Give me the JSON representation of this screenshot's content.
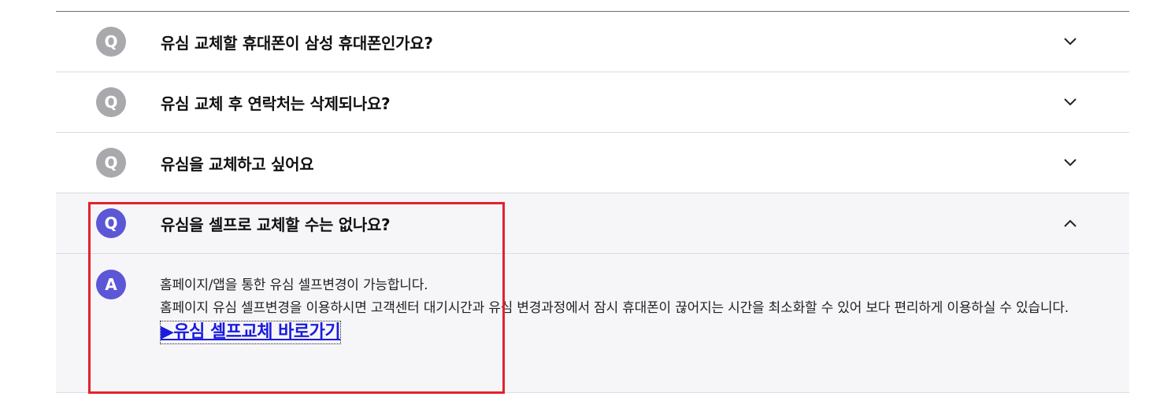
{
  "faq": {
    "items": [
      {
        "q_badge": "Q",
        "question": "유심 교체할 휴대폰이 삼성 휴대폰인가요?",
        "expanded": false
      },
      {
        "q_badge": "Q",
        "question": "유심 교체 후 연락처는 삭제되나요?",
        "expanded": false
      },
      {
        "q_badge": "Q",
        "question": "유심을 교체하고 싶어요",
        "expanded": false
      },
      {
        "q_badge": "Q",
        "question": "유심을 셀프로 교체할 수는 없나요?",
        "expanded": true
      }
    ],
    "answer": {
      "a_badge": "A",
      "line1": "홈페이지/앱을 통한 유심 셀프변경이 가능합니다.",
      "line2": "홈페이지 유심 셀프변경을 이용하시면 고객센터 대기시간과 유심 변경과정에서 잠시 휴대폰이 끊어지는 시간을 최소화할 수 있어 보다 편리하게 이용하실 수 있습니다.",
      "link": "▶유심 셀프교체 바로가기"
    }
  },
  "colors": {
    "active_badge": "#5b57d6",
    "inactive_badge": "#a9a9ad",
    "link": "#1a1ae0",
    "highlight": "#e3222d"
  },
  "icons": {
    "collapsed": "chevron-down-icon",
    "expanded": "chevron-up-icon"
  }
}
